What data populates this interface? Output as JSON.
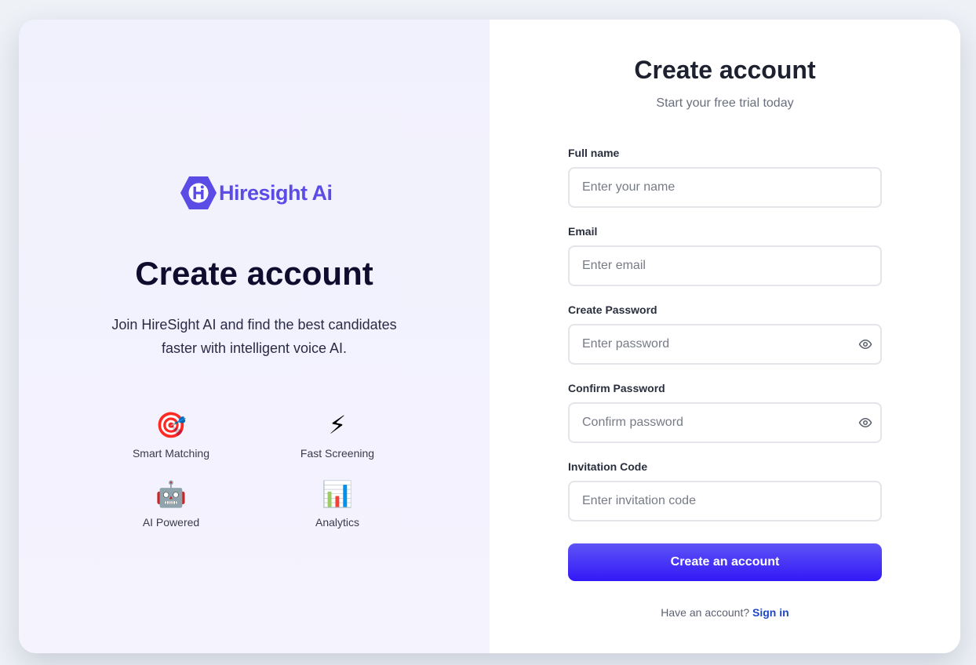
{
  "brand": {
    "logo_text": "Hiresight Ai",
    "logo_mark_letter": "H",
    "brand_color": "#5b4ce6"
  },
  "hero": {
    "title": "Create account",
    "subtitle": "Join HireSight AI and find the best candidates faster with intelligent voice AI.",
    "features": [
      {
        "icon": "target-icon",
        "glyph": "🎯",
        "label": "Smart Matching"
      },
      {
        "icon": "lightning-icon",
        "glyph": "⚡",
        "label": "Fast Screening"
      },
      {
        "icon": "robot-icon",
        "glyph": "🤖",
        "label": "AI Powered"
      },
      {
        "icon": "bar-chart-icon",
        "glyph": "📊",
        "label": "Analytics"
      }
    ]
  },
  "form": {
    "title": "Create account",
    "subtitle": "Start your free trial today",
    "fields": {
      "full_name": {
        "label": "Full name",
        "placeholder": "Enter your name",
        "value": ""
      },
      "email": {
        "label": "Email",
        "placeholder": "Enter email",
        "value": ""
      },
      "password": {
        "label": "Create Password",
        "placeholder": "Enter password",
        "value": ""
      },
      "confirm_password": {
        "label": "Confirm Password",
        "placeholder": "Confirm password",
        "value": ""
      },
      "invitation_code": {
        "label": "Invitation Code",
        "placeholder": "Enter invitation code",
        "value": ""
      }
    },
    "submit_label": "Create an account",
    "signin_prompt": "Have an account?",
    "signin_link": "Sign in"
  },
  "colors": {
    "accent": "#3318f7",
    "link": "#2046c2"
  }
}
